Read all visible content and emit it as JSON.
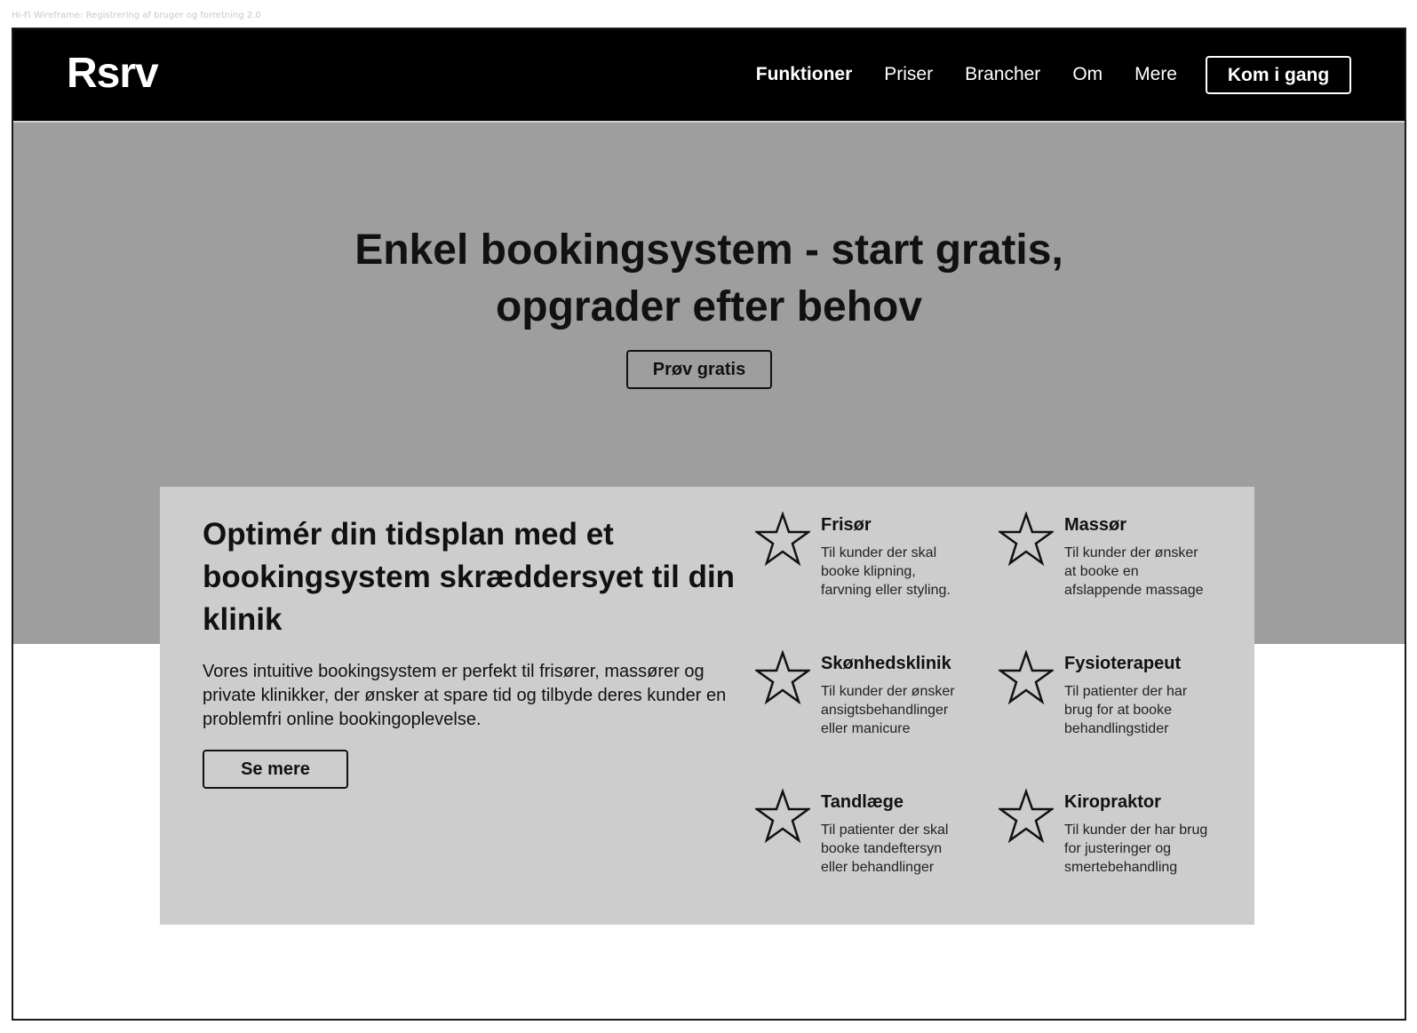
{
  "frame_label": "Hi-Fi Wireframe: Registrering af bruger og forretning 2.0",
  "nav": {
    "logo": "Rsrv",
    "links": [
      "Funktioner",
      "Priser",
      "Brancher",
      "Om",
      "Mere"
    ],
    "cta": "Kom i gang"
  },
  "hero": {
    "title_line1": "Enkel bookingsystem - start gratis,",
    "title_line2": "opgrader efter behov",
    "cta": "Prøv gratis"
  },
  "section": {
    "title": "Optimér din tidsplan med et bookingsystem skræddersyet til din klinik",
    "body": "Vores intuitive bookingsystem er perfekt til frisører, massører og private klinikker, der ønsker at spare tid og tilbyde deres kunder en problemfri online bookingoplevelse.",
    "cta": "Se mere",
    "features": [
      {
        "title": "Frisør",
        "desc": "Til kunder der skal booke klipning, farvning eller styling.",
        "icon": "star-icon"
      },
      {
        "title": "Massør",
        "desc": "Til kunder der ønsker at booke en afslappende massage",
        "icon": "star-icon"
      },
      {
        "title": "Skønhedsklinik",
        "desc": "Til kunder der ønsker ansigtsbehandlinger eller manicure",
        "icon": "star-icon"
      },
      {
        "title": "Fysioterapeut",
        "desc": "Til patienter der har brug for at booke behandlingstider",
        "icon": "star-icon"
      },
      {
        "title": "Tandlæge",
        "desc": "Til patienter der skal booke tandeftersyn eller behandlinger",
        "icon": "star-icon"
      },
      {
        "title": "Kiropraktor",
        "desc": "Til kunder der har brug for justeringer og smertebehandling",
        "icon": "star-icon"
      }
    ]
  }
}
